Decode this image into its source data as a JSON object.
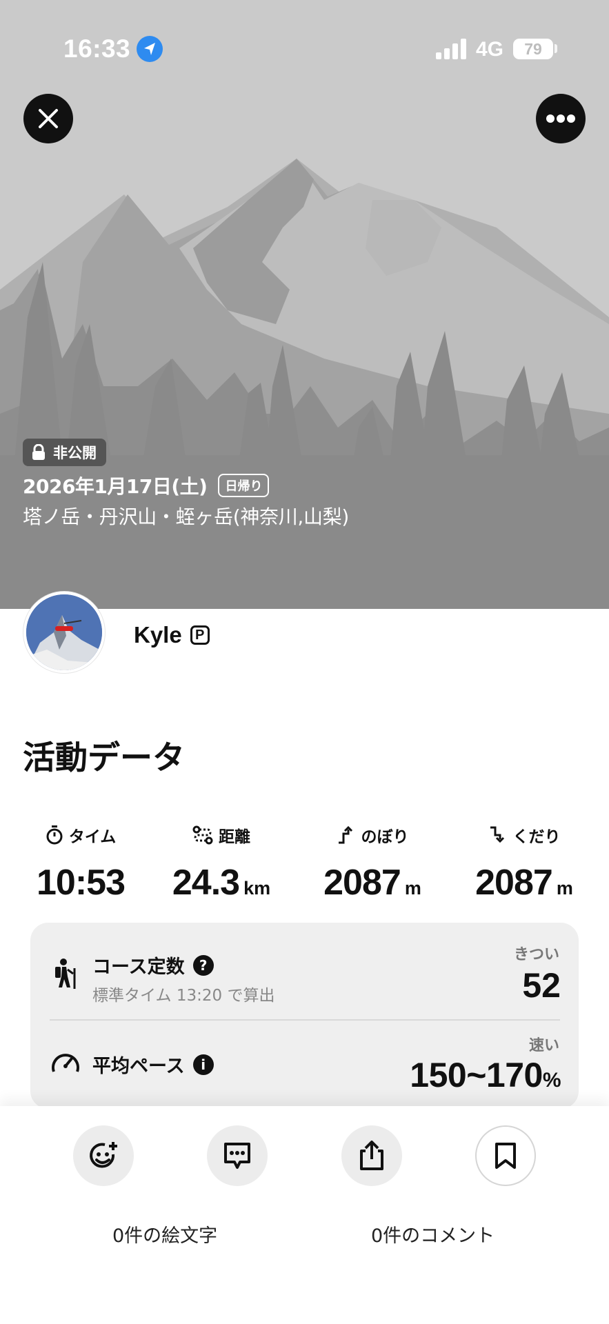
{
  "status_bar": {
    "time": "16:33",
    "network": "4G",
    "battery": "79",
    "text_color": "#ffffff"
  },
  "hero": {
    "private_label": "非公開",
    "date": "2026年1月17日(土)",
    "day_tag": "日帰り",
    "route": "塔ノ岳・丹沢山・蛭ヶ岳(神奈川,山梨)",
    "background_color": "#c9c9c9"
  },
  "profile": {
    "username": "Kyle",
    "premium_mark": "P"
  },
  "activity": {
    "title": "活動データ",
    "stats": [
      {
        "label": "タイム",
        "value": "10:53",
        "unit": "",
        "icon": "stopwatch-icon"
      },
      {
        "label": "距離",
        "value": "24.3",
        "unit": "km",
        "icon": "route-icon"
      },
      {
        "label": "のぼり",
        "value": "2087",
        "unit": "m",
        "icon": "ascent-icon"
      },
      {
        "label": "くだり",
        "value": "2087",
        "unit": "m",
        "icon": "descent-icon"
      }
    ],
    "course": {
      "label": "コース定数",
      "help": "?",
      "sub": "標準タイム 13:20 で算出",
      "grade": "きつい",
      "value": "52"
    },
    "pace": {
      "label": "平均ペース",
      "info": "i",
      "grade": "速い",
      "value": "150~170",
      "unit": "%"
    }
  },
  "bottom": {
    "emoji_count": "0件の絵文字",
    "comment_count": "0件のコメント"
  }
}
